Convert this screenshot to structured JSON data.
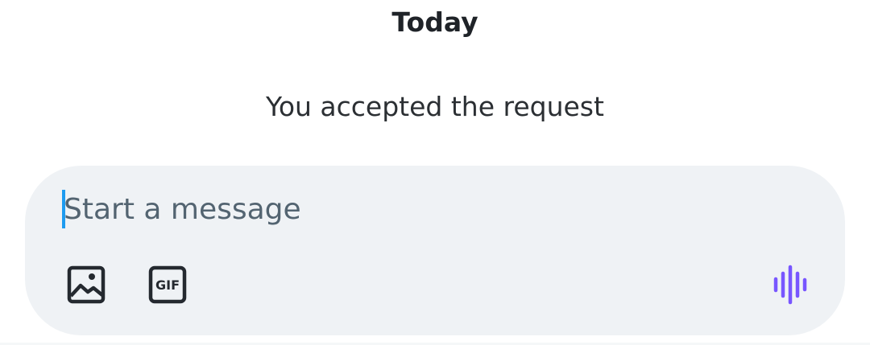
{
  "thread": {
    "date_label": "Today",
    "system_message": "You accepted the request"
  },
  "composer": {
    "placeholder": "Start a message",
    "value": "",
    "media_icon": "image-icon",
    "gif_icon": "gif-icon",
    "gif_label": "GIF",
    "voice_icon": "voice-waveform-icon",
    "accent_color": "#1d9bf0",
    "voice_color": "#7856ff"
  }
}
